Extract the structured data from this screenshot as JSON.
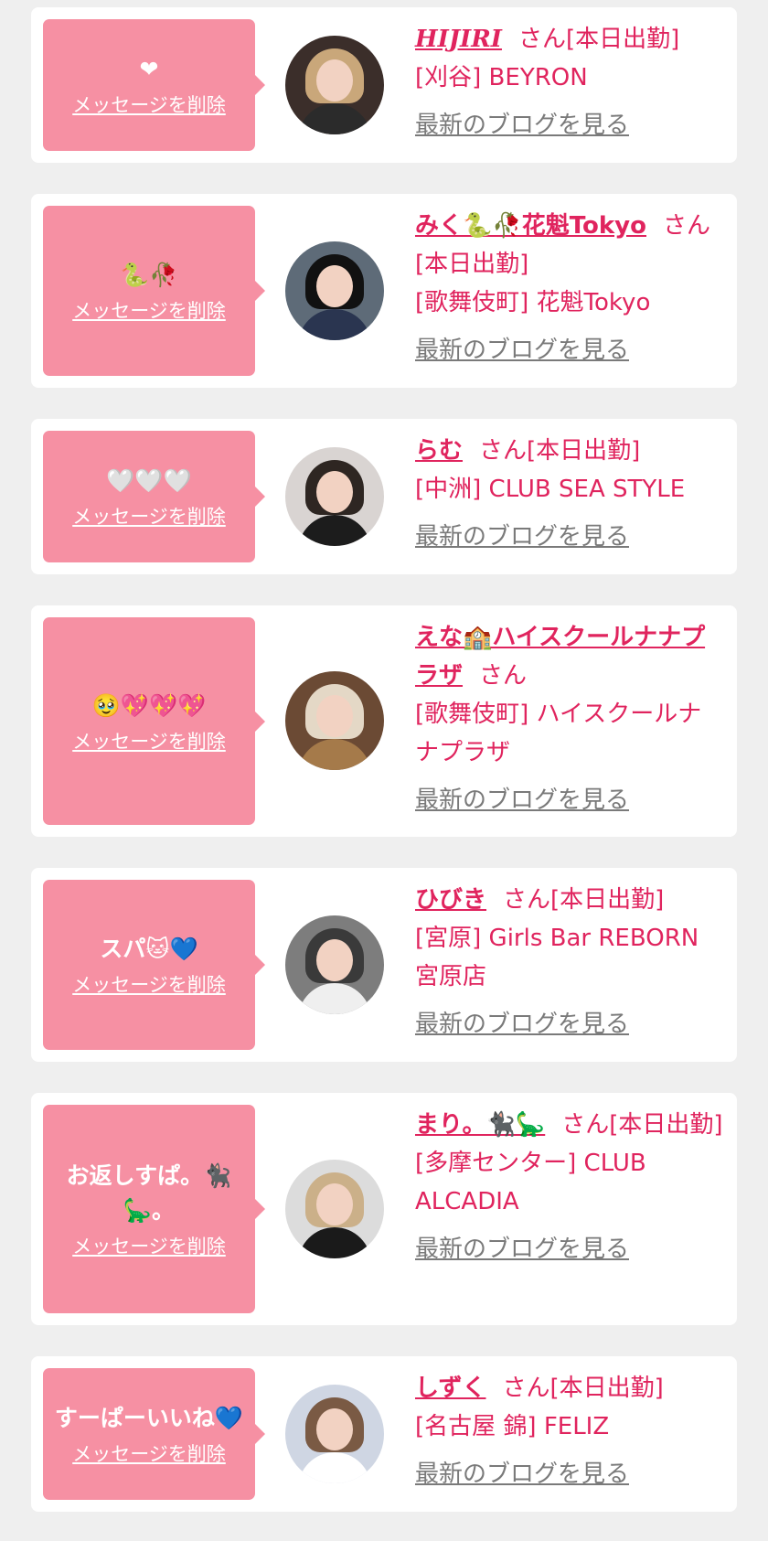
{
  "entries": [
    {
      "message": "❤",
      "delete_label": "メッセージを削除",
      "name": "HIJIRI",
      "suffix": "さん[本日出勤]",
      "shop": "[刈谷] BEYRON",
      "blog_label": "最新のブログを見る",
      "avatar": {
        "bg": "#3b2e2a",
        "hair": "#c9a77a",
        "body": "#2b2b2b"
      }
    },
    {
      "message": "🐍🥀",
      "delete_label": "メッセージを削除",
      "name": "みく🐍🥀花魁Tokyo",
      "suffix": "さん[本日出勤]",
      "shop": "[歌舞伎町] 花魁Tokyo",
      "blog_label": "最新のブログを見る",
      "avatar": {
        "bg": "#5e6b78",
        "hair": "#111111",
        "body": "#2a3550"
      }
    },
    {
      "message": "🤍🤍🤍",
      "delete_label": "メッセージを削除",
      "name": "らむ",
      "suffix": "さん[本日出勤]",
      "shop": "[中洲] CLUB SEA STYLE",
      "blog_label": "最新のブログを見る",
      "avatar": {
        "bg": "#d9d4d2",
        "hair": "#2e2622",
        "body": "#1c1c1c"
      }
    },
    {
      "message": "🥹💖💖💖",
      "delete_label": "メッセージを削除",
      "name": "えな🏫ハイスクールナナプラザ",
      "suffix": "さん",
      "shop": "[歌舞伎町] ハイスクールナナプラザ",
      "blog_label": "最新のブログを見る",
      "avatar": {
        "bg": "#6b4a34",
        "hair": "#e4d8c6",
        "body": "#a57a4a"
      }
    },
    {
      "message": "スパ🐱💙",
      "delete_label": "メッセージを削除",
      "name": "ひびき",
      "suffix": "さん[本日出勤]",
      "shop": "[宮原] Girls Bar REBORN 宮原店",
      "blog_label": "最新のブログを見る",
      "avatar": {
        "bg": "#7d7d7d",
        "hair": "#3a3a3a",
        "body": "#efefef"
      }
    },
    {
      "message": "お返しすぱ。🐈‍⬛🦕。",
      "delete_label": "メッセージを削除",
      "name": "まり。🐈‍⬛🦕",
      "suffix": "さん[本日出勤]",
      "shop": "[多摩センター] CLUB ALCADIA",
      "blog_label": "最新のブログを見る",
      "avatar": {
        "bg": "#dcdcdc",
        "hair": "#cbb089",
        "body": "#1a1a1a"
      }
    },
    {
      "message": "すーぱーいいね💙",
      "delete_label": "メッセージを削除",
      "name": "しずく",
      "suffix": "さん[本日出勤]",
      "shop": "[名古屋 錦] FELIZ",
      "blog_label": "最新のブログを見る",
      "avatar": {
        "bg": "#cfd6e3",
        "hair": "#7a5a44",
        "body": "#ffffff"
      }
    }
  ]
}
